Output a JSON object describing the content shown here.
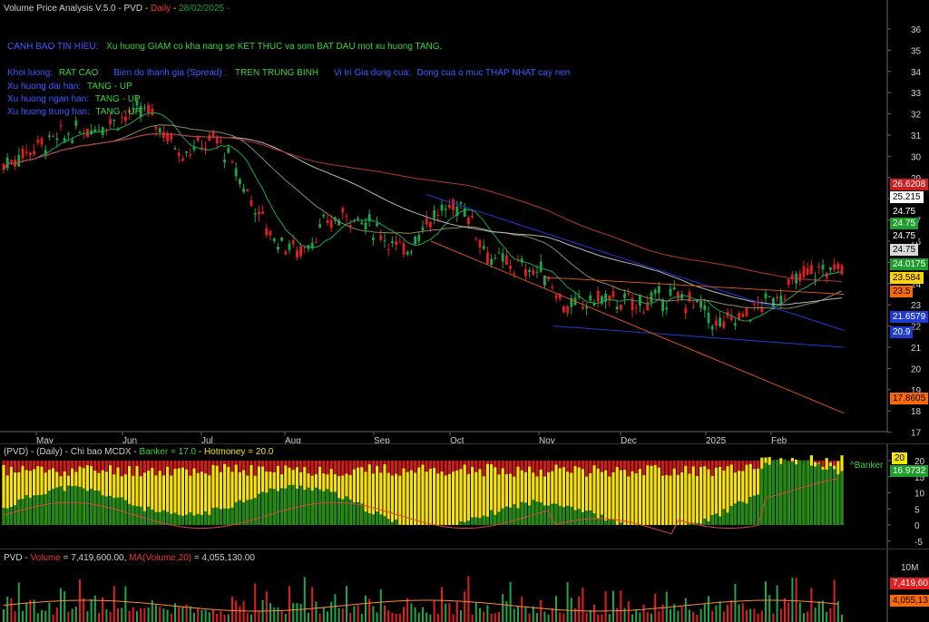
{
  "title": {
    "indicator": "Volume Price Analysis V.5.0",
    "ticker": "PVD",
    "interval": "Daily",
    "date": "28/02/2025"
  },
  "signals": {
    "warning_label": "CANH BAO TIN HIEU:",
    "warning_text": "Xu huong GIAM co kha nang se KET THUC va som BAT DAU mot xu huong TANG.",
    "volume_label": "Khoi luong:",
    "volume_value": "RAT CAO",
    "spread_label": "Bien do thanh gia (Spread) :",
    "spread_value": "TREN TRUNG BINH",
    "close_label": "Vi tri Gia dong cua:",
    "close_value": "Dong cua o muc THAP NHAT cay nen",
    "long_label": "Xu huong dai han:",
    "long_value": "TANG - UP",
    "short_label": "Xu huong ngan han:",
    "short_value": "TANG - UP",
    "mid_label": "Xu huong trung han:",
    "mid_value": "TANG - UP"
  },
  "price_axis": {
    "ticks": [
      "36",
      "35",
      "34",
      "33",
      "32",
      "31",
      "30",
      "29",
      "28",
      "27",
      "26",
      "25",
      "24",
      "23",
      "22",
      "21",
      "20",
      "19",
      "18",
      "17"
    ]
  },
  "price_tags": [
    {
      "label": "26.6208",
      "bg": "#cc1f1f",
      "fg": "#ffffff"
    },
    {
      "label": "25.215",
      "bg": "#ffffff",
      "fg": "#000000"
    },
    {
      "label": "24.75",
      "bg": "#000000",
      "fg": "#ffffff"
    },
    {
      "label": "24.75",
      "bg": "#1e9e2a",
      "fg": "#ffffff"
    },
    {
      "label": "24.75",
      "bg": "#000000",
      "fg": "#ffffff"
    },
    {
      "label": "24.75",
      "bg": "#d9d9d9",
      "fg": "#000000"
    },
    {
      "label": "24.0175",
      "bg": "#1e9e2a",
      "fg": "#ffffff"
    },
    {
      "label": "23.584",
      "bg": "#ffd400",
      "fg": "#000000"
    },
    {
      "label": "23.5",
      "bg": "#ff6a00",
      "fg": "#000000"
    },
    {
      "label": "21.6579",
      "bg": "#1f3bd1",
      "fg": "#ffffff"
    },
    {
      "label": "20.9",
      "bg": "#1f3bd1",
      "fg": "#ffffff"
    },
    {
      "label": "17.8605",
      "bg": "#ff6a00",
      "fg": "#000000"
    }
  ],
  "months": [
    "May",
    "Jun",
    "Jul",
    "Aug",
    "Sep",
    "Oct",
    "Nov",
    "Dec",
    "2025",
    "Feb"
  ],
  "mcdx": {
    "ticker": "(PVD)",
    "interval": "(Daily)",
    "name": "Chi bao MCDX",
    "banker": "Banker = 17.0",
    "hotmoney": "Hotmoney = 20.0",
    "axis_ticks": [
      "20",
      "15",
      "10",
      "5",
      "0",
      "-5"
    ],
    "tag_hot": "20",
    "tag_banker": "16.9732",
    "banker_marker": "^Banker"
  },
  "volume": {
    "ticker": "PVD",
    "volume_label": "Volume",
    "volume_value": "7,419,600.00",
    "ma_label": "MA(Volume,20)",
    "ma_value": "4,055,130.00",
    "axis_tick": "10M",
    "tag_volume": "7,419,60",
    "tag_ma": "4,055,13"
  },
  "colors": {
    "up": "#1ea64a",
    "down": "#e02020",
    "banker": "#1a8a1a",
    "hotmoney": "#f2e600",
    "retail": "#d11a1a",
    "ma_short": "#1ea64a",
    "ma_mid": "#c79a5a",
    "ma_long": "#b03a2e",
    "channel_blue": "#1f3bd1",
    "channel_orange": "#d2541b"
  }
}
